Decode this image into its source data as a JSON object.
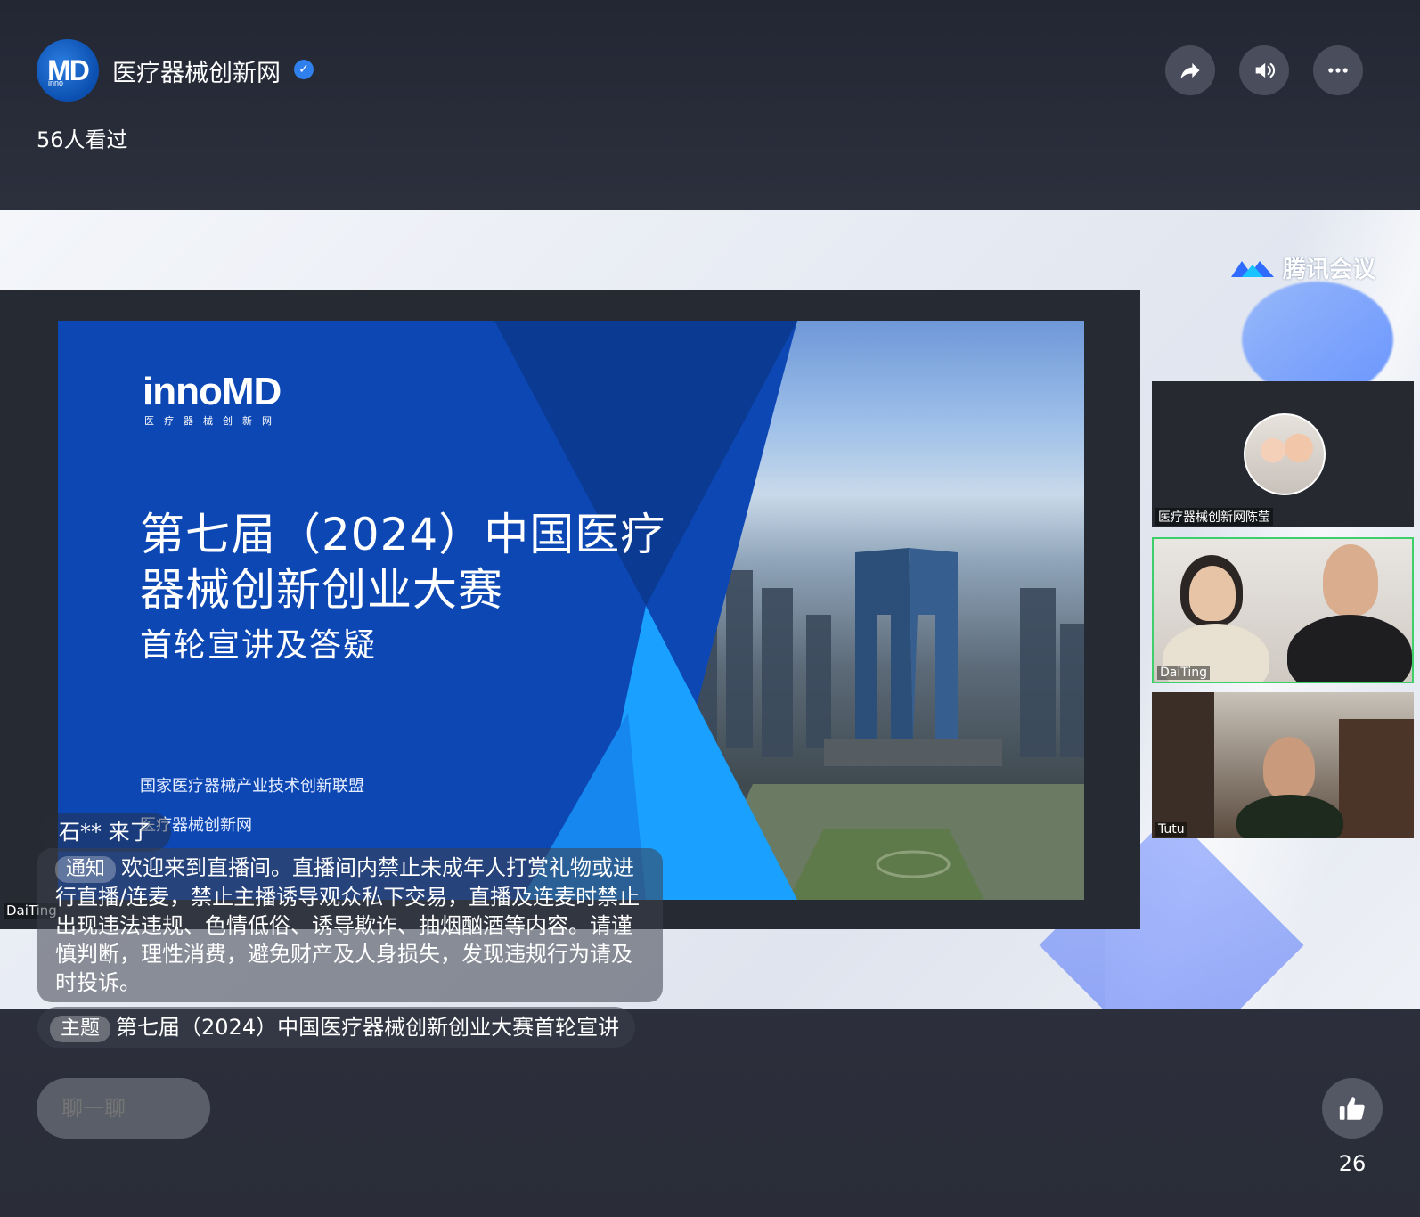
{
  "header": {
    "channel_name": "医疗器械创新网",
    "viewers_text": "56人看过",
    "logo_text": "MD",
    "logo_sub": "inno"
  },
  "stage": {
    "watermark": "腾讯会议",
    "slide": {
      "logo": "innoMD",
      "logo_sub": "医疗器械创新网",
      "title_line1": "第七届（2024）中国医疗",
      "title_line2": "器械创新创业大赛",
      "subtitle": "首轮宣讲及答疑",
      "org1": "国家医疗器械产业技术创新联盟",
      "org2": "医疗器械创新网"
    },
    "share_label": "DaiTing",
    "participants": [
      {
        "name": "医疗器械创新网陈莹"
      },
      {
        "name": "DaiTing"
      },
      {
        "name": "Tutu"
      }
    ]
  },
  "overlays": {
    "join_message": "石** 来了",
    "notice_tag": "通知",
    "notice_text": "欢迎来到直播间。直播间内禁止未成年人打赏礼物或进行直播/连麦，禁止主播诱导观众私下交易，直播及连麦时禁止出现违法违规、色情低俗、诱导欺诈、抽烟酗酒等内容。请谨慎判断，理性消费，避免财产及人身损失，发现违规行为请及时投诉。",
    "topic_tag": "主题",
    "topic_text": "第七届（2024）中国医疗器械创新创业大赛首轮宣讲"
  },
  "footer": {
    "chat_placeholder": "聊一聊",
    "like_count": "26"
  },
  "icons": {
    "share": "share-icon",
    "volume": "volume-icon",
    "more": "more-icon",
    "like": "thumbs-up-icon",
    "verified": "verified-icon"
  },
  "colors": {
    "accent_blue": "#2f80ed",
    "speaking_border": "#3ecf6a",
    "slide_blue": "#0b3f9c"
  }
}
